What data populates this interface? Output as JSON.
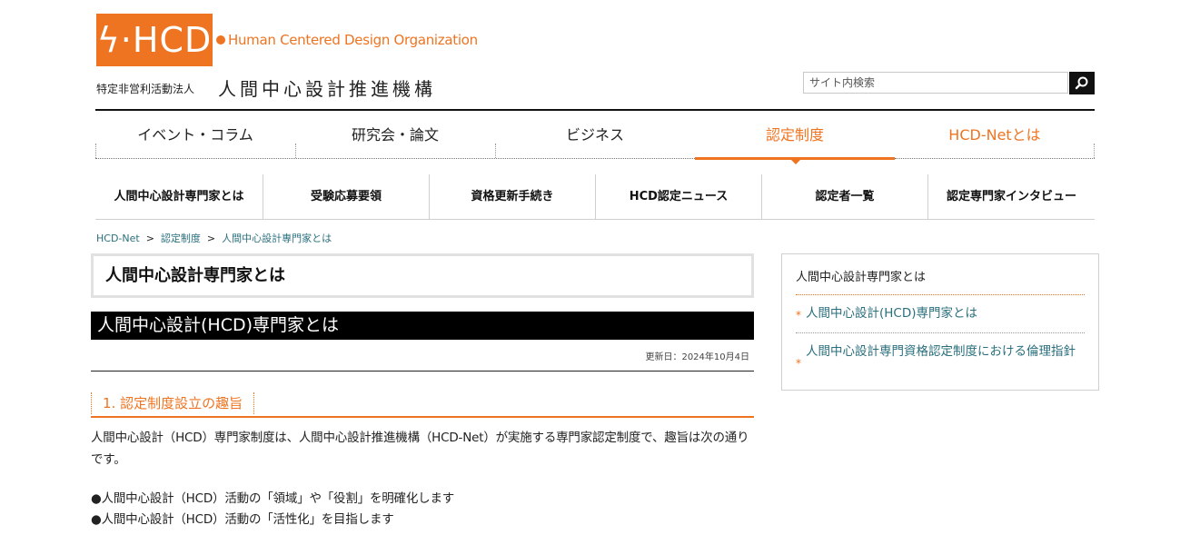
{
  "header": {
    "logo_text": "ϟ·HCD",
    "tagline": "Human Centered Design Organization",
    "org_sub": "特定非営利活動法人",
    "org_main": "人間中心設計推進機構"
  },
  "search": {
    "placeholder": "サイト内検索"
  },
  "main_nav": [
    {
      "label": "イベント・コラム"
    },
    {
      "label": "研究会・論文"
    },
    {
      "label": "ビジネス"
    },
    {
      "label": "認定制度"
    },
    {
      "label": "HCD-Netとは"
    }
  ],
  "sub_nav": [
    {
      "label": "人間中心設計専門家とは"
    },
    {
      "label": "受験応募要領"
    },
    {
      "label": "資格更新手続き"
    },
    {
      "label": "HCD認定ニュース"
    },
    {
      "label": "認定者一覧"
    },
    {
      "label": "認定専門家インタビュー"
    }
  ],
  "breadcrumb": [
    {
      "label": "HCD-Net"
    },
    {
      "label": "認定制度"
    },
    {
      "label": "人間中心設計専門家とは"
    }
  ],
  "breadcrumb_sep": ">",
  "content": {
    "page_title": "人間中心設計専門家とは",
    "heading": "人間中心設計(HCD)専門家とは",
    "updated": "更新日：2024年10月4日",
    "section_heading": "1. 認定制度設立の趣旨",
    "intro": "人間中心設計（HCD）専門家制度は、人間中心設計推進機構（HCD-Net）が実施する専門家認定制度で、趣旨は次の通りです。",
    "bullets": [
      "●人間中心設計（HCD）活動の「領域」や「役割」を明確化します",
      "●人間中心設計（HCD）活動の「活性化」を目指します"
    ]
  },
  "side_menu": {
    "title": "人間中心設計専門家とは",
    "links": [
      {
        "label": "人間中心設計(HCD)専門家とは"
      },
      {
        "label": "人間中心設計専門資格認定制度における倫理指針"
      }
    ],
    "bullet_glyph": "*"
  },
  "colors": {
    "accent": "#ee7422",
    "link": "#2a6f7d",
    "heading_bg": "#000000"
  }
}
